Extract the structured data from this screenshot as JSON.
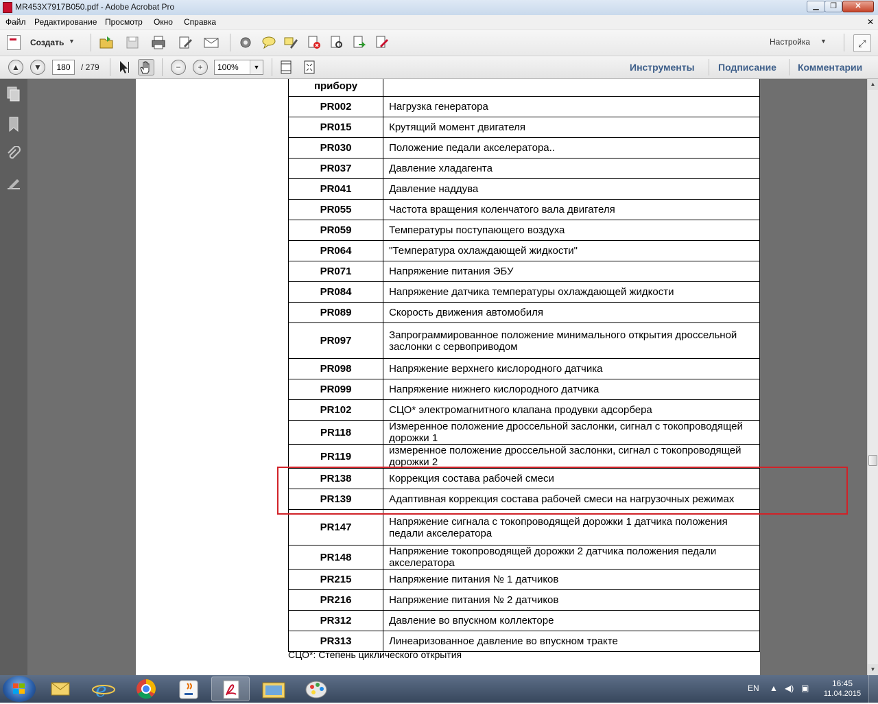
{
  "window": {
    "title": "MR453X7917B050.pdf - Adobe Acrobat Pro"
  },
  "menu": {
    "items": [
      "Файл",
      "Редактирование",
      "Просмотр",
      "Окно",
      "Справка"
    ]
  },
  "toolbar": {
    "create_label": "Создать",
    "settings_label": "Настройка"
  },
  "navigation": {
    "current_page": "180",
    "total_pages": "/ 279",
    "zoom": "100%"
  },
  "panels": {
    "tools": "Инструменты",
    "sign": "Подписание",
    "comments": "Комментарии"
  },
  "table": {
    "header_code": "прибору",
    "rows": [
      {
        "code": "PR002",
        "desc": "Нагрузка генератора"
      },
      {
        "code": "PR015",
        "desc": "Крутящий момент двигателя"
      },
      {
        "code": "PR030",
        "desc": "Положение педали акселератора.."
      },
      {
        "code": "PR037",
        "desc": "Давление хладагента"
      },
      {
        "code": "PR041",
        "desc": "Давление наддува"
      },
      {
        "code": "PR055",
        "desc": "Частота вращения коленчатого вала двигателя"
      },
      {
        "code": "PR059",
        "desc": "Температуры поступающего воздуха"
      },
      {
        "code": "PR064",
        "desc": "\"Температура охлаждающей жидкости\""
      },
      {
        "code": "PR071",
        "desc": "Напряжение питания ЭБУ"
      },
      {
        "code": "PR084",
        "desc": "Напряжение датчика температуры охлаждающей жидкости"
      },
      {
        "code": "PR089",
        "desc": "Скорость движения автомобиля"
      },
      {
        "code": "PR097",
        "desc": "Запрограммированное положение минимального открытия дроссельной заслонки с сервоприводом"
      },
      {
        "code": "PR098",
        "desc": "Напряжение верхнего кислородного датчика"
      },
      {
        "code": "PR099",
        "desc": "Напряжение нижнего кислородного датчика"
      },
      {
        "code": "PR102",
        "desc": "СЦО* электромагнитного клапана продувки адсорбера"
      },
      {
        "code": "PR118",
        "desc": "Измеренное положение дроссельной заслонки, сигнал с токопроводящей дорожки 1"
      },
      {
        "code": "PR119",
        "desc": "измеренное положение дроссельной заслонки, сигнал с токопроводящей дорожки 2"
      },
      {
        "code": "PR138",
        "desc": "Коррекция состава рабочей смеси"
      },
      {
        "code": "PR139",
        "desc": "Адаптивная коррекция состава рабочей смеси на нагрузочных режимах"
      },
      {
        "code": "PR147",
        "desc": "Напряжение сигнала с токопроводящей дорожки 1 датчика положения педали акселератора"
      },
      {
        "code": "PR148",
        "desc": "Напряжение токопроводящей дорожки 2 датчика положения педали акселератора"
      },
      {
        "code": "PR215",
        "desc": "Напряжение питания № 1 датчиков"
      },
      {
        "code": "PR216",
        "desc": "Напряжение питания № 2 датчиков"
      },
      {
        "code": "PR312",
        "desc": "Давление во впускном коллекторе"
      },
      {
        "code": "PR313",
        "desc": "Линеаризованное давление во впускном тракте"
      }
    ]
  },
  "footnote": "СЦО*: Степень циклического открытия",
  "highlight": {
    "color": "#d12228",
    "rows": [
      "PR138",
      "PR139"
    ]
  },
  "taskbar": {
    "language": "EN",
    "time": "16:45",
    "date": "11.04.2015"
  },
  "colors": {
    "panel_tab": "#3e5f8a",
    "acrobat_red": "#c8102e"
  }
}
